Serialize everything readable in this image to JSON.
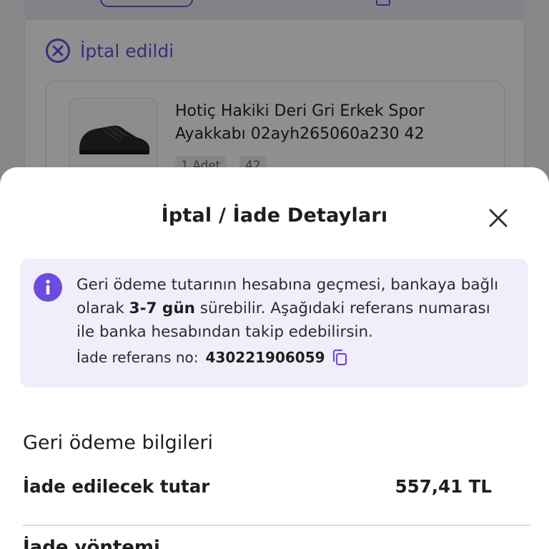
{
  "background": {
    "status_text": "İptal edildi",
    "product": {
      "title_line1": "Hotiç Hakiki Deri Gri Erkek Spor",
      "title_line2": "Ayakkabı 02ayh265060a230 42",
      "quantity_chip": "1 Adet",
      "size_chip": "42"
    }
  },
  "sheet": {
    "title": "İptal / İade Detayları",
    "info": {
      "text_before": "Geri ödeme tutarının hesabına geçmesi, bankaya bağlı olarak ",
      "text_bold": "3-7 gün",
      "text_after": " sürebilir. Aşağıdaki referans numarası ile banka hesabından takip edebilirsin.",
      "ref_label": "İade referans no:",
      "ref_value": "430221906059"
    },
    "refund_section": {
      "title": "Geri ödeme bilgileri",
      "amount_label": "İade edilecek tutar",
      "amount_value": "557,41 TL",
      "next_label": "İade yöntemi"
    }
  },
  "colors": {
    "accent": "#6f4ae0",
    "info_bg": "#f1eefb"
  }
}
